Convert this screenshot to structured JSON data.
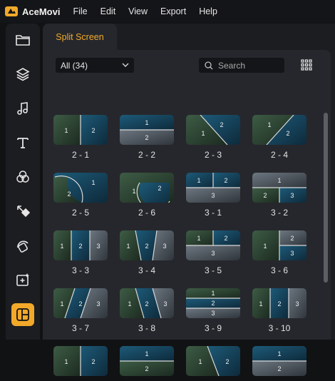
{
  "app": {
    "name": "AceMovi"
  },
  "menu": [
    "File",
    "Edit",
    "View",
    "Export",
    "Help"
  ],
  "sidebar": {
    "items": [
      {
        "icon": "folder-icon"
      },
      {
        "icon": "layers-icon"
      },
      {
        "icon": "music-icon"
      },
      {
        "icon": "text-icon"
      },
      {
        "icon": "filters-icon"
      },
      {
        "icon": "transitions-icon"
      },
      {
        "icon": "stickers-icon"
      },
      {
        "icon": "effects-icon"
      },
      {
        "icon": "split-screen-icon",
        "active": true
      }
    ],
    "accent": "#f2a92a"
  },
  "panel": {
    "tab_label": "Split Screen",
    "filter_value": "All (34)",
    "search_placeholder": "Search"
  },
  "templates": [
    {
      "label": "2 - 1",
      "nums": [
        "1",
        "2"
      ]
    },
    {
      "label": "2 - 2",
      "nums": [
        "1",
        "2"
      ]
    },
    {
      "label": "2 - 3",
      "nums": [
        "1",
        "2"
      ]
    },
    {
      "label": "2 - 4",
      "nums": [
        "1",
        "2"
      ]
    },
    {
      "label": "2 - 5",
      "nums": [
        "1",
        "2"
      ]
    },
    {
      "label": "2 - 6",
      "nums": [
        "1",
        "2"
      ]
    },
    {
      "label": "3 - 1",
      "nums": [
        "1",
        "2",
        "3"
      ]
    },
    {
      "label": "3 - 2",
      "nums": [
        "1",
        "2",
        "3"
      ]
    },
    {
      "label": "3 - 3",
      "nums": [
        "1",
        "2",
        "3"
      ]
    },
    {
      "label": "3 - 4",
      "nums": [
        "1",
        "2",
        "3"
      ]
    },
    {
      "label": "3 - 5",
      "nums": [
        "1",
        "2",
        "3"
      ]
    },
    {
      "label": "3 - 6",
      "nums": [
        "1",
        "2",
        "3"
      ]
    },
    {
      "label": "3 - 7",
      "nums": [
        "1",
        "2",
        "3"
      ]
    },
    {
      "label": "3 - 8",
      "nums": [
        "1",
        "2",
        "3"
      ]
    },
    {
      "label": "3 - 9",
      "nums": [
        "1",
        "2",
        "3"
      ]
    },
    {
      "label": "3 - 10",
      "nums": [
        "1",
        "2",
        "3"
      ]
    },
    {
      "label": "",
      "nums": [
        "1",
        "2"
      ]
    },
    {
      "label": "",
      "nums": [
        "1",
        "2"
      ]
    },
    {
      "label": "",
      "nums": [
        "1",
        "2"
      ]
    },
    {
      "label": "",
      "nums": [
        "1",
        "2"
      ]
    }
  ]
}
